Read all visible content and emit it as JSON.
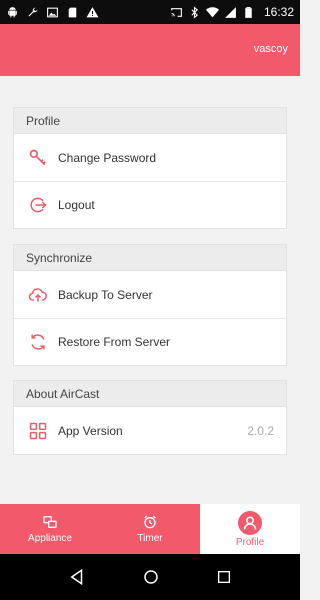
{
  "status_bar": {
    "time": "16:32",
    "left_icons": [
      "android-icon",
      "wrench-icon",
      "image-icon",
      "sd-card-icon",
      "warning-icon"
    ],
    "right_icons": [
      "cast-icon",
      "bluetooth-icon",
      "wifi-icon",
      "signal-icon",
      "battery-icon"
    ]
  },
  "header": {
    "username": "vascoy"
  },
  "sections": {
    "profile": {
      "title": "Profile",
      "items": [
        {
          "label": "Change Password",
          "icon": "key-icon"
        },
        {
          "label": "Logout",
          "icon": "logout-icon"
        }
      ]
    },
    "synchronize": {
      "title": "Synchronize",
      "items": [
        {
          "label": "Backup To Server",
          "icon": "cloud-upload-icon"
        },
        {
          "label": "Restore From Server",
          "icon": "sync-icon"
        }
      ]
    },
    "about": {
      "title": "About AirCast",
      "items": [
        {
          "label": "App Version",
          "value": "2.0.2",
          "icon": "grid-icon"
        }
      ]
    }
  },
  "bottom_nav": {
    "items": [
      {
        "label": "Appliance",
        "icon": "appliance-icon",
        "active": false
      },
      {
        "label": "Timer",
        "icon": "timer-icon",
        "active": false
      },
      {
        "label": "Profile",
        "icon": "profile-icon",
        "active": true
      }
    ]
  },
  "colors": {
    "accent": "#f25a6b",
    "background": "#f2f2f2",
    "section_header": "#ececec"
  }
}
